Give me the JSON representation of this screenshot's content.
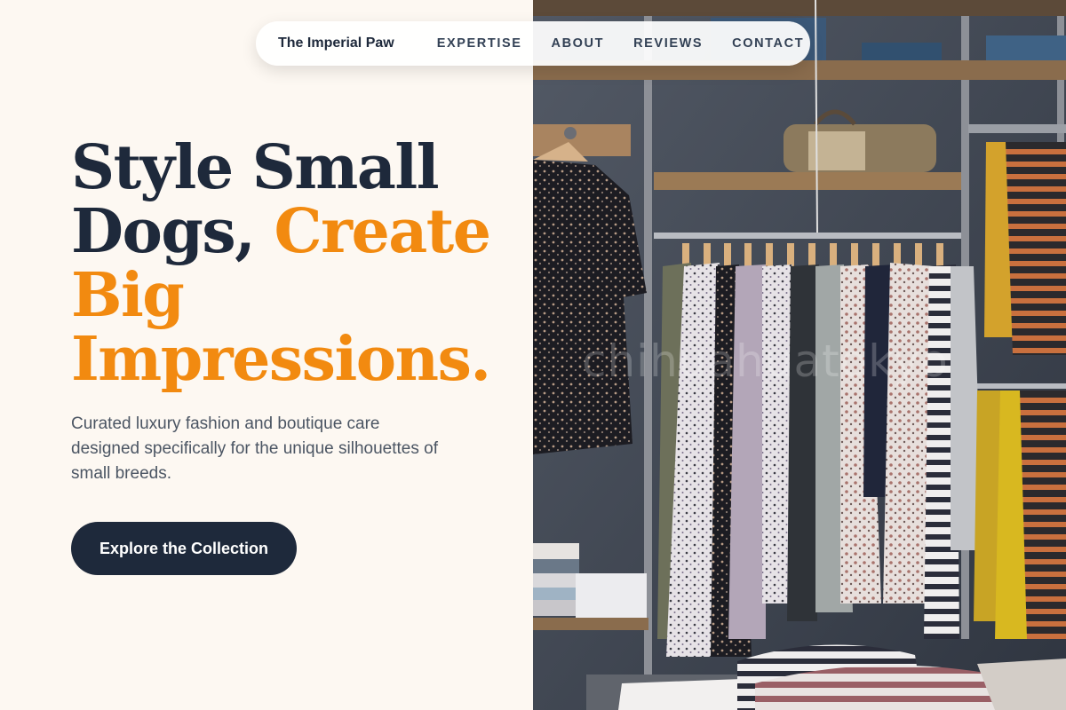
{
  "nav": {
    "brand": "The Imperial Paw",
    "links": [
      "EXPERTISE",
      "ABOUT",
      "REVIEWS",
      "CONTACT"
    ]
  },
  "hero": {
    "title_line1": "Style Small",
    "title_line2_plain": "Dogs, ",
    "title_line2_accent": "Create",
    "title_line3": "Big",
    "title_line4": "Impressions.",
    "subtitle": "Curated luxury fashion and boutique care designed specifically for the unique silhouettes of small breeds.",
    "cta_label": "Explore the Collection"
  },
  "image": {
    "watermark": "chihuahuatokyo",
    "subject": "boutique clothing rack with hanging dresses, shelves with folded garments and handbags"
  },
  "colors": {
    "background": "#fdf8f2",
    "navy": "#1e293b",
    "accent": "#f28a10",
    "body_text": "#4b5563"
  }
}
